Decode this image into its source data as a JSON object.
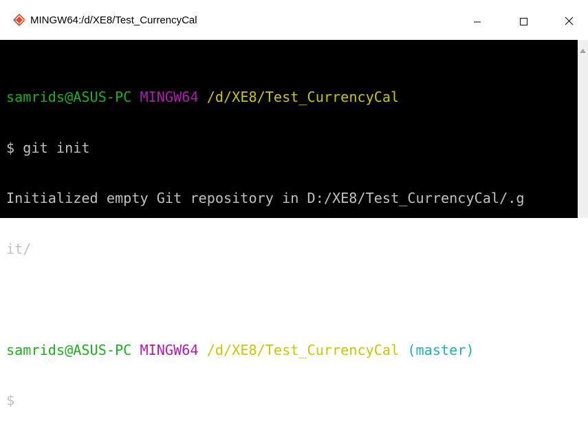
{
  "window": {
    "title": "MINGW64:/d/XE8/Test_CurrencyCal",
    "icons": {
      "app": "git-bash-diamond-icon",
      "minimize": "minimize-icon",
      "maximize": "maximize-icon",
      "close": "close-icon",
      "scroll_up": "scroll-up-arrow-icon"
    }
  },
  "colors": {
    "user_host": "#1ab21a",
    "system": "#b21ab2",
    "path": "#c8c800",
    "branch": "#1ab2b2",
    "text": "#c0c0c0",
    "background": "#000000"
  },
  "terminal": {
    "prompt1": {
      "user_host": "samrids@ASUS-PC",
      "system": "MINGW64",
      "path": "/d/XE8/Test_CurrencyCal"
    },
    "command1": "$ git init",
    "output_line1": "Initialized empty Git repository in D:/XE8/Test_CurrencyCal/.g",
    "output_line2": "it/",
    "prompt2": {
      "user_host": "samrids@ASUS-PC",
      "system": "MINGW64",
      "path": "/d/XE8/Test_CurrencyCal",
      "branch": "(master)"
    },
    "command2": "$"
  }
}
